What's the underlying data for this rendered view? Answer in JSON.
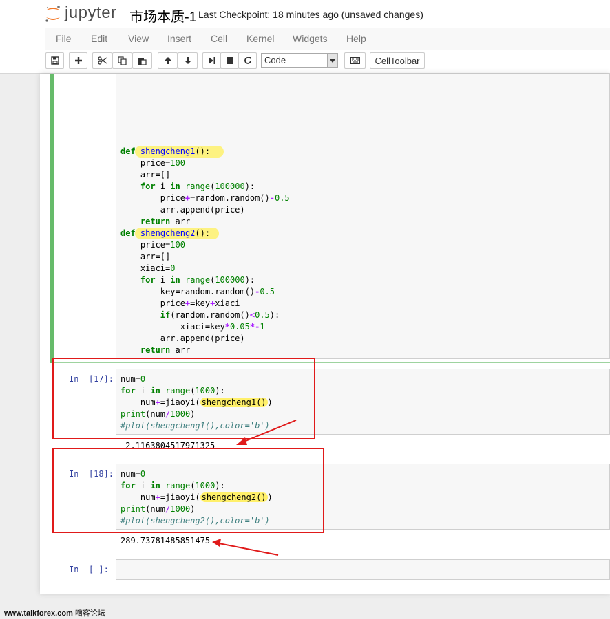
{
  "app": {
    "logo_text": "jupyter",
    "notebook_title": "市场本质-1",
    "checkpoint_text": "Last Checkpoint: 18 minutes ago (unsaved changes)"
  },
  "menu": [
    "File",
    "Edit",
    "View",
    "Insert",
    "Cell",
    "Kernel",
    "Widgets",
    "Help"
  ],
  "toolbar": {
    "buttons": [
      "save-icon",
      "plus-icon",
      "cut-icon",
      "copy-icon",
      "paste-icon",
      "arrow-up-icon",
      "arrow-down-icon",
      "run-icon",
      "stop-icon",
      "restart-icon"
    ],
    "cell_type": "Code",
    "keyboard_icon": "keyboard-icon",
    "celltoolbar_label": "CellToolbar"
  },
  "cells": {
    "cell1": {
      "lines": [
        "def shengcheng1():",
        "    price=100",
        "    arr=[]",
        "    for i in range(100000):",
        "        price+=random.random()-0.5",
        "        arr.append(price)",
        "    return arr",
        "def shengcheng2():",
        "    price=100",
        "    arr=[]",
        "    xiaci=0",
        "    for i in range(100000):",
        "        key=random.random()-0.5",
        "        price+=key+xiaci",
        "        if(random.random()<0.5):",
        "            xiaci=key*0.05*-1",
        "        arr.append(price)",
        "    return arr"
      ]
    },
    "cell2": {
      "prompt": "In  [17]:",
      "lines": [
        "num=0",
        "for i in range(1000):",
        "    num+=jiaoyi(shengcheng1())",
        "print(num/1000)",
        "#plot(shengcheng1(),color='b')"
      ],
      "output": "-2.1163804517971325"
    },
    "cell3": {
      "prompt": "In  [18]:",
      "lines": [
        "num=0",
        "for i in range(1000):",
        "    num+=jiaoyi(shengcheng2())",
        "print(num/1000)",
        "#plot(shengcheng2(),color='b')"
      ],
      "output": "289.73781485851475"
    },
    "cell4": {
      "prompt": "In  [ ]:"
    }
  },
  "watermark": {
    "site": "www.talkforex.com",
    "cn": "嘀客论坛"
  },
  "colors": {
    "keyword": "#008000",
    "operator": "#aa22ff",
    "prompt": "#303f9f",
    "highlight": "#fff06a",
    "annotation_red": "#e01a1a",
    "selected_cell": "#66bb6a"
  }
}
